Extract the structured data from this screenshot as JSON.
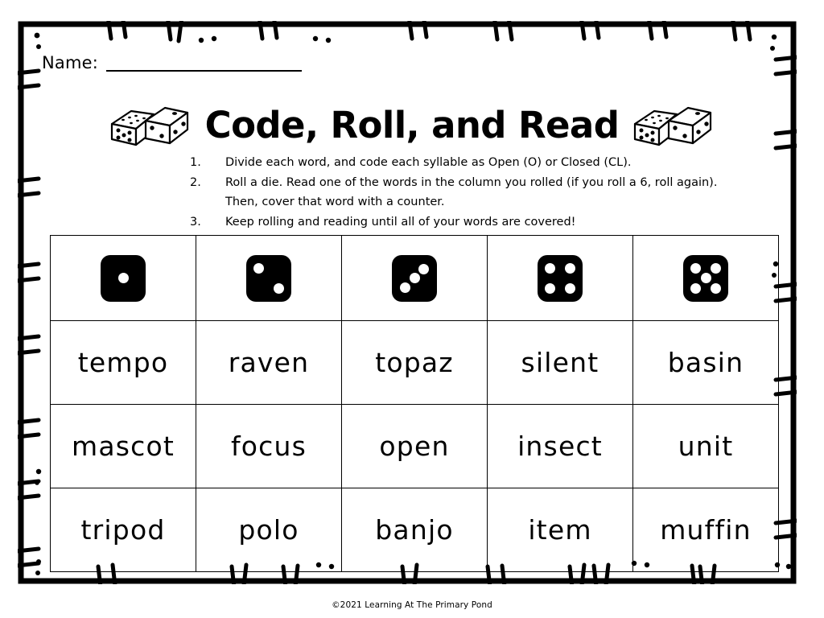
{
  "page": {
    "name_label": "Name:",
    "title": "Code, Roll, and Read",
    "footer_credit": "©2021 Learning At The Primary Pond",
    "ink_color": "#000000",
    "paper_color": "#ffffff"
  },
  "instructions": [
    {
      "number": "1.",
      "text": "Divide each word, and code each syllable as Open (O) or Closed (CL)."
    },
    {
      "number": "2.",
      "text": "Roll a die. Read one of the words in the column you rolled (if you roll a 6, roll again). Then, cover that word with a counter."
    },
    {
      "number": "3.",
      "text": "Keep rolling and reading until all of your words are covered!"
    }
  ],
  "table": {
    "dice_headers": [
      {
        "value": 1,
        "label": "die-showing-one"
      },
      {
        "value": 2,
        "label": "die-showing-two"
      },
      {
        "value": 3,
        "label": "die-showing-three"
      },
      {
        "value": 4,
        "label": "die-showing-four"
      },
      {
        "value": 5,
        "label": "die-showing-five"
      }
    ],
    "rows": [
      [
        "tempo",
        "raven",
        "topaz",
        "silent",
        "basin"
      ],
      [
        "mascot",
        "focus",
        "open",
        "insect",
        "unit"
      ],
      [
        "tripod",
        "polo",
        "banjo",
        "item",
        "muffin"
      ]
    ]
  },
  "decorations": {
    "left_dice_art": "pair-of-dice-clipart",
    "right_dice_art": "pair-of-dice-clipart",
    "border_style": "hand-drawn-stitched-line"
  }
}
